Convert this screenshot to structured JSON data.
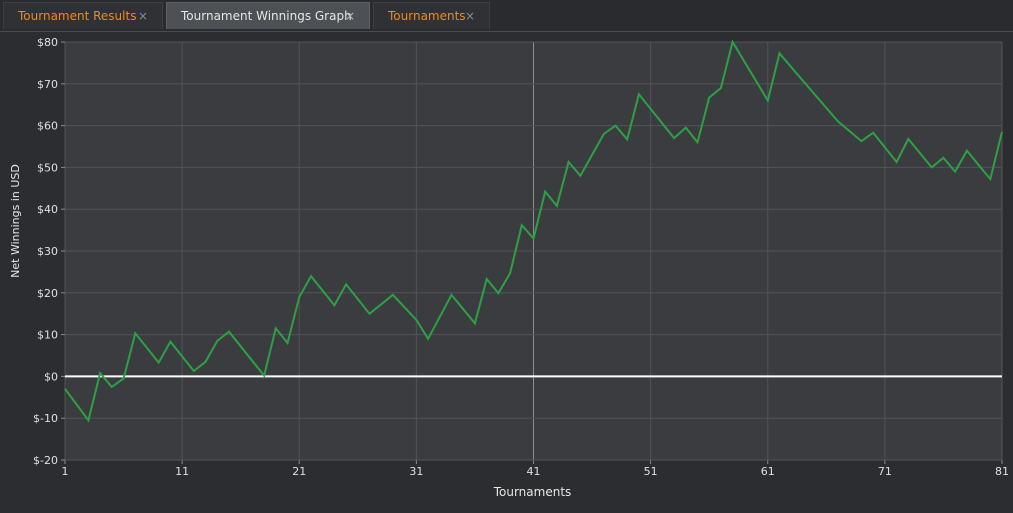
{
  "tabs": [
    {
      "label": "Tournament Results",
      "active": false
    },
    {
      "label": "Tournament Winnings Graph",
      "active": true
    },
    {
      "label": "Tournaments",
      "active": false
    }
  ],
  "close_glyph": "×",
  "colors": {
    "tab_label": "#f08a1c",
    "line": "#2ea043",
    "zero_line": "#ffffff",
    "plot_bg": "#3a3c40",
    "grid": "#505357"
  },
  "chart_data": {
    "type": "line",
    "xlabel": "Tournaments",
    "ylabel": "Net Winnings in USD",
    "xlim": [
      1,
      81
    ],
    "ylim": [
      -20,
      80
    ],
    "x_ticks": [
      1,
      11,
      21,
      31,
      41,
      51,
      61,
      71,
      81
    ],
    "y_ticks": [
      80,
      70,
      60,
      50,
      40,
      30,
      20,
      10,
      0,
      -10,
      -20
    ],
    "y_tick_labels": [
      "$80",
      "$70",
      "$60",
      "$50",
      "$40",
      "$30",
      "$20",
      "$10",
      "$0",
      "$-10",
      "$-20"
    ],
    "grid": true,
    "series": [
      {
        "x": [
          1,
          3,
          4,
          5,
          6,
          7,
          9,
          10,
          12,
          13,
          14,
          15,
          18,
          19,
          20,
          21,
          22,
          24,
          25,
          27,
          29,
          31,
          32,
          34,
          36,
          37,
          38,
          39,
          40,
          41,
          42,
          43,
          44,
          45,
          46,
          47,
          48,
          49,
          50,
          53,
          54,
          55,
          56,
          57,
          58,
          61,
          62,
          63,
          67,
          69,
          70,
          72,
          73,
          75,
          76,
          77,
          78,
          80,
          81
        ],
        "y": [
          -3,
          -10.5,
          0.8,
          -2.5,
          -0.5,
          10.3,
          3.3,
          8.3,
          1.3,
          3.5,
          8.5,
          10.7,
          0.2,
          11.5,
          8,
          19,
          24,
          17,
          22,
          15,
          19.5,
          13.5,
          9,
          19.5,
          12.7,
          23.3,
          19.9,
          24.7,
          36.2,
          33,
          44.2,
          40.8,
          51.3,
          48,
          53,
          58,
          60,
          56.7,
          67.5,
          57,
          59.5,
          56,
          66.7,
          69,
          80,
          66,
          77.3,
          74,
          61,
          56.3,
          58.3,
          51.3,
          56.8,
          50,
          52.3,
          49,
          54,
          47.2,
          58.5
        ]
      }
    ]
  }
}
